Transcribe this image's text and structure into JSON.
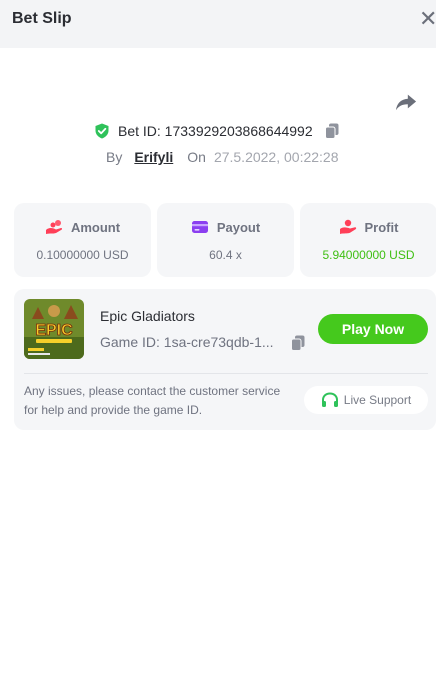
{
  "header": {
    "title": "Bet Slip"
  },
  "bet": {
    "id_text": "Bet ID: 1733929203868644992",
    "by_label": "By",
    "user": "Erifyli",
    "on_label": "On",
    "date": "27.5.2022, 00:22:28"
  },
  "stats": [
    {
      "label": "Amount",
      "value": "0.10000000 USD",
      "icon": "coins-hand-icon"
    },
    {
      "label": "Payout",
      "value": "60.4 x",
      "icon": "card-icon"
    },
    {
      "label": "Profit",
      "value": "5.94000000 USD",
      "icon": "hand-coin-icon"
    }
  ],
  "game": {
    "name": "Epic Gladiators",
    "id_text": "Game ID: 1sa-cre73qdb-1...",
    "thumb_title": "EPIC",
    "play_label": "Play Now"
  },
  "support": {
    "message": "Any issues, please contact the customer service for help and provide the game ID.",
    "button_label": "Live Support"
  },
  "colors": {
    "accent_green": "#45c91d",
    "profit_green": "#3fbf13",
    "shield_green": "#2fc25a"
  }
}
